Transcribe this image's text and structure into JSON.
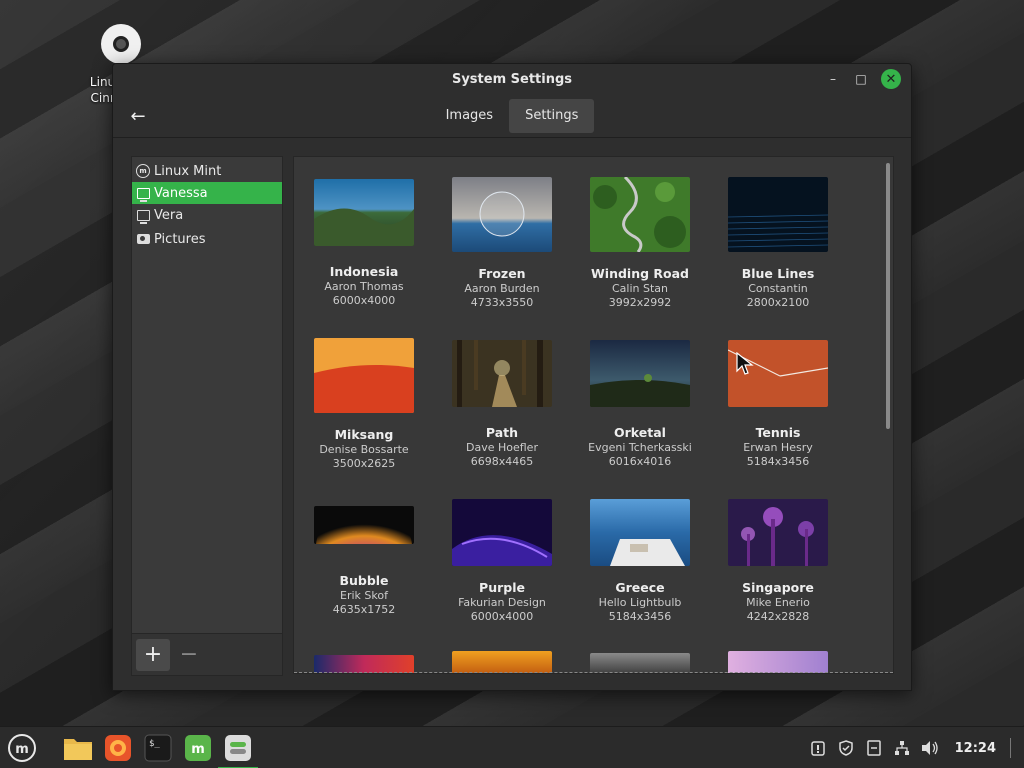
{
  "desktop": {
    "icon_label": "Linux Mint Cinnamon"
  },
  "window": {
    "title": "System Settings",
    "controls": {
      "minimize": "–",
      "maximize": "□",
      "close": "✕"
    }
  },
  "toolbar": {
    "back_icon": "←",
    "tabs": [
      {
        "label": "Images",
        "active": false
      },
      {
        "label": "Settings",
        "active": true
      }
    ]
  },
  "sidebar": {
    "items": [
      {
        "label": "Linux Mint",
        "icon": "mint-icon",
        "selected": false
      },
      {
        "label": "Vanessa",
        "icon": "monitor-icon",
        "selected": true
      },
      {
        "label": "Vera",
        "icon": "monitor-icon",
        "selected": false
      },
      {
        "label": "Pictures",
        "icon": "camera-icon",
        "selected": false
      }
    ],
    "add_label": "+",
    "remove_label": "−"
  },
  "wallpapers": [
    {
      "name": "Indonesia",
      "author": "Aaron Thomas",
      "size": "6000x4000"
    },
    {
      "name": "Frozen",
      "author": "Aaron Burden",
      "size": "4733x3550"
    },
    {
      "name": "Winding Road",
      "author": "Calin Stan",
      "size": "3992x2992"
    },
    {
      "name": "Blue Lines",
      "author": "Constantin",
      "size": "2800x2100"
    },
    {
      "name": "Miksang",
      "author": "Denise Bossarte",
      "size": "3500x2625"
    },
    {
      "name": "Path",
      "author": "Dave Hoefler",
      "size": "6698x4465"
    },
    {
      "name": "Orketal",
      "author": "Evgeni Tcherkasski",
      "size": "6016x4016"
    },
    {
      "name": "Tennis",
      "author": "Erwan Hesry",
      "size": "5184x3456"
    },
    {
      "name": "Bubble",
      "author": "Erik Skof",
      "size": "4635x1752"
    },
    {
      "name": "Purple",
      "author": "Fakurian Design",
      "size": "6000x4000"
    },
    {
      "name": "Greece",
      "author": "Hello Lightbulb",
      "size": "5184x3456"
    },
    {
      "name": "Singapore",
      "author": "Mike Enerio",
      "size": "4242x2828"
    }
  ],
  "taskbar": {
    "apps": [
      "menu-icon",
      "files-icon",
      "firefox-icon",
      "terminal-icon",
      "mintinstall-icon",
      "settings-icon"
    ],
    "tray": [
      "update-icon",
      "shield-icon",
      "notes-icon",
      "network-icon",
      "volume-icon"
    ],
    "clock": "12:24"
  },
  "colors": {
    "accent": "#35b34a",
    "window_bg": "#2e2e2e",
    "panel_bg": "#383838"
  }
}
